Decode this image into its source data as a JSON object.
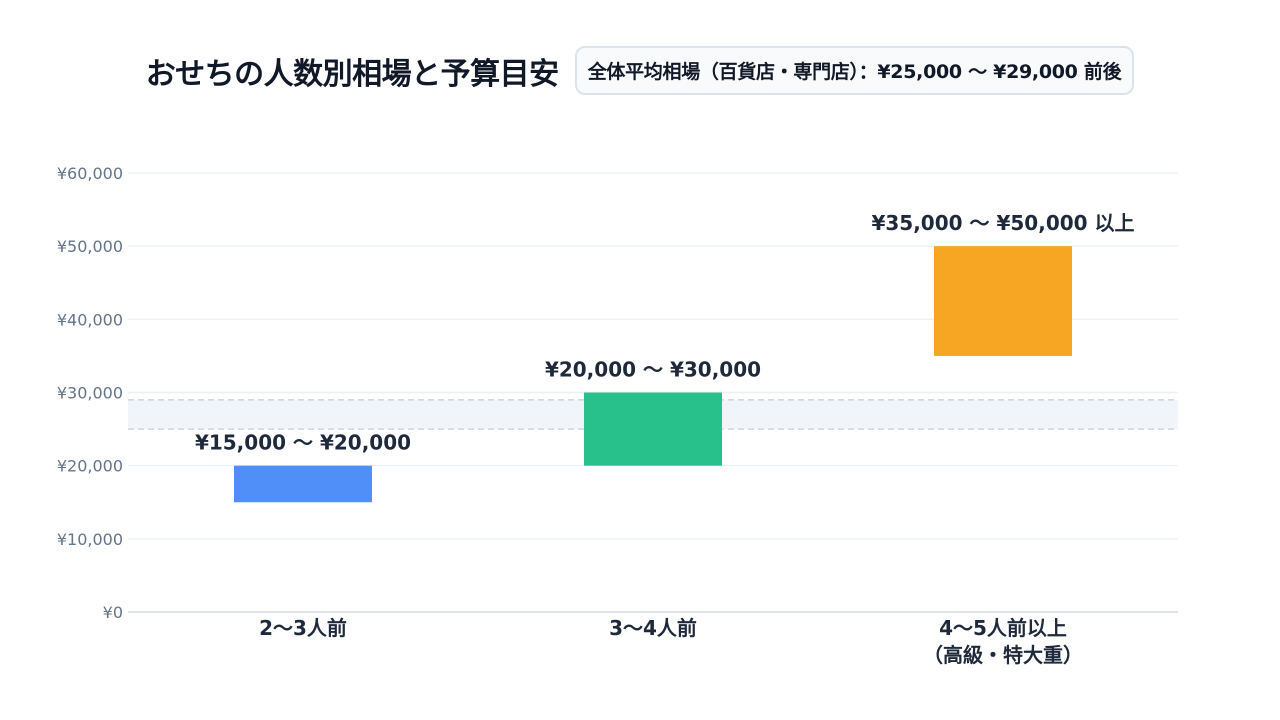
{
  "header": {
    "title": "おせちの人数別相場と予算目安",
    "badge": "全体平均相場（百貨店・専門店）：¥25,000 〜 ¥29,000 前後"
  },
  "chart_data": {
    "type": "bar",
    "title": "おせちの人数別相場と予算目安",
    "xlabel": "",
    "ylabel": "",
    "ylim": [
      0,
      60000
    ],
    "yticks": [
      {
        "value": 0,
        "label": "¥0"
      },
      {
        "value": 10000,
        "label": "¥10,000"
      },
      {
        "value": 20000,
        "label": "¥20,000"
      },
      {
        "value": 30000,
        "label": "¥30,000"
      },
      {
        "value": 40000,
        "label": "¥40,000"
      },
      {
        "value": 50000,
        "label": "¥50,000"
      },
      {
        "value": 60000,
        "label": "¥60,000"
      }
    ],
    "grid": true,
    "categories": [
      {
        "lines": [
          "2〜3人前"
        ]
      },
      {
        "lines": [
          "3〜4人前"
        ]
      },
      {
        "lines": [
          "4〜5人前以上",
          "（高級・特大重）"
        ]
      }
    ],
    "ranges": [
      {
        "low": 15000,
        "high": 20000,
        "label": "¥15,000 〜 ¥20,000",
        "color": "#4f8ff7"
      },
      {
        "low": 20000,
        "high": 30000,
        "label": "¥20,000 〜 ¥30,000",
        "color": "#28c18c"
      },
      {
        "low": 35000,
        "high": 50000,
        "label": "¥35,000 〜 ¥50,000 以上",
        "color": "#f6a623"
      }
    ],
    "reference_band": {
      "low": 25000,
      "high": 29000,
      "label": "全体平均相場（百貨店・専門店）：¥25,000 〜 ¥29,000 前後"
    }
  }
}
